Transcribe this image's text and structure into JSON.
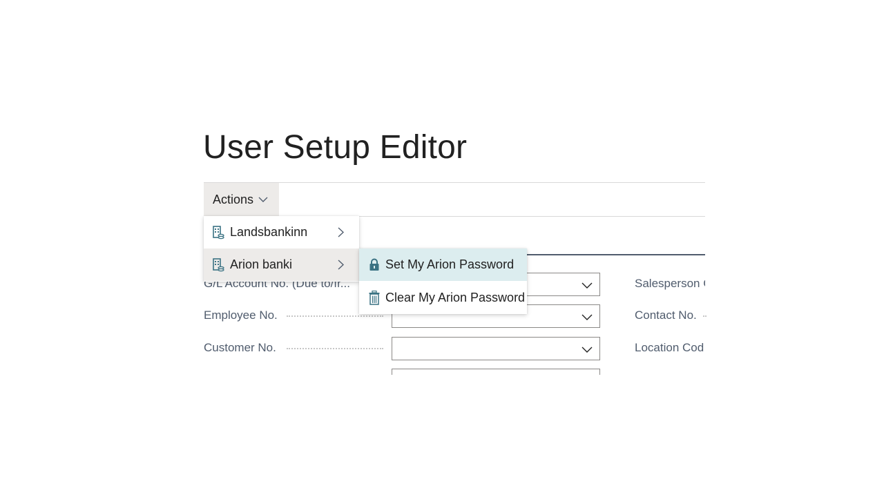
{
  "page": {
    "title": "User Setup Editor"
  },
  "action_bar": {
    "actions_label": "Actions"
  },
  "actions_menu": {
    "items": [
      {
        "label": "Landsbankinn",
        "icon": "bank-icon",
        "has_submenu": true
      },
      {
        "label": "Arion banki",
        "icon": "bank-icon",
        "has_submenu": true
      }
    ]
  },
  "arion_submenu": {
    "items": [
      {
        "label": "Set My Arion Password",
        "icon": "lock-icon"
      },
      {
        "label": "Clear My Arion Password",
        "icon": "trash-icon"
      }
    ]
  },
  "form": {
    "fields": [
      {
        "label": "G/L Account No. (Due to/fr...",
        "value": ""
      },
      {
        "label": "Employee No.",
        "value": ""
      },
      {
        "label": "Customer No.",
        "value": ""
      }
    ],
    "right_fields": [
      {
        "label": "Salesperson C"
      },
      {
        "label": "Contact No."
      },
      {
        "label": "Location Cod"
      }
    ]
  },
  "colors": {
    "accent": "#505c6d",
    "menu_hover": "#edebe9",
    "submenu_highlight": "#dcedef",
    "icon_teal": "#3a7283"
  }
}
